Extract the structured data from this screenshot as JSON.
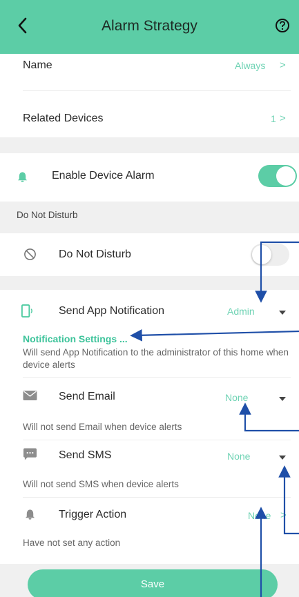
{
  "header": {
    "title": "Alarm Strategy",
    "back_icon": "chevron-left-icon",
    "help_icon": "help-circle-icon",
    "color": "#5ccda6"
  },
  "general": {
    "name_label": "Name",
    "name_value": "Always",
    "chevron": ">",
    "related_label": "Related Devices",
    "related_value": "1"
  },
  "enable_alarm": {
    "label": "Enable Device Alarm",
    "icon": "bell-icon",
    "enabled": true
  },
  "dnd_section": {
    "title": "Do Not Disturb",
    "label": "Do Not Disturb",
    "icon": "block-icon",
    "enabled": false
  },
  "notifications": {
    "app": {
      "label": "Send App Notification",
      "value": "Admin",
      "icon": "phone-notification-icon",
      "settings_link": "Notification Settings",
      "description": "Will send App Notification to the administrator of this home when device alerts"
    },
    "email": {
      "label": "Send Email",
      "value": "None",
      "icon": "envelope-icon",
      "description": "Will not send Email when device alerts"
    },
    "sms": {
      "label": "Send SMS",
      "value": "None",
      "icon": "sms-icon",
      "description": "Will not send SMS when device alerts"
    },
    "trigger": {
      "label": "Trigger Action",
      "value": "None",
      "chevron": ">",
      "icon": "bell-icon",
      "description": "Have not set any action"
    }
  },
  "save_label": "Save",
  "colors": {
    "accent": "#5ccda6",
    "value_text": "#6fd3b4",
    "annotation": "#1f4fa8"
  }
}
